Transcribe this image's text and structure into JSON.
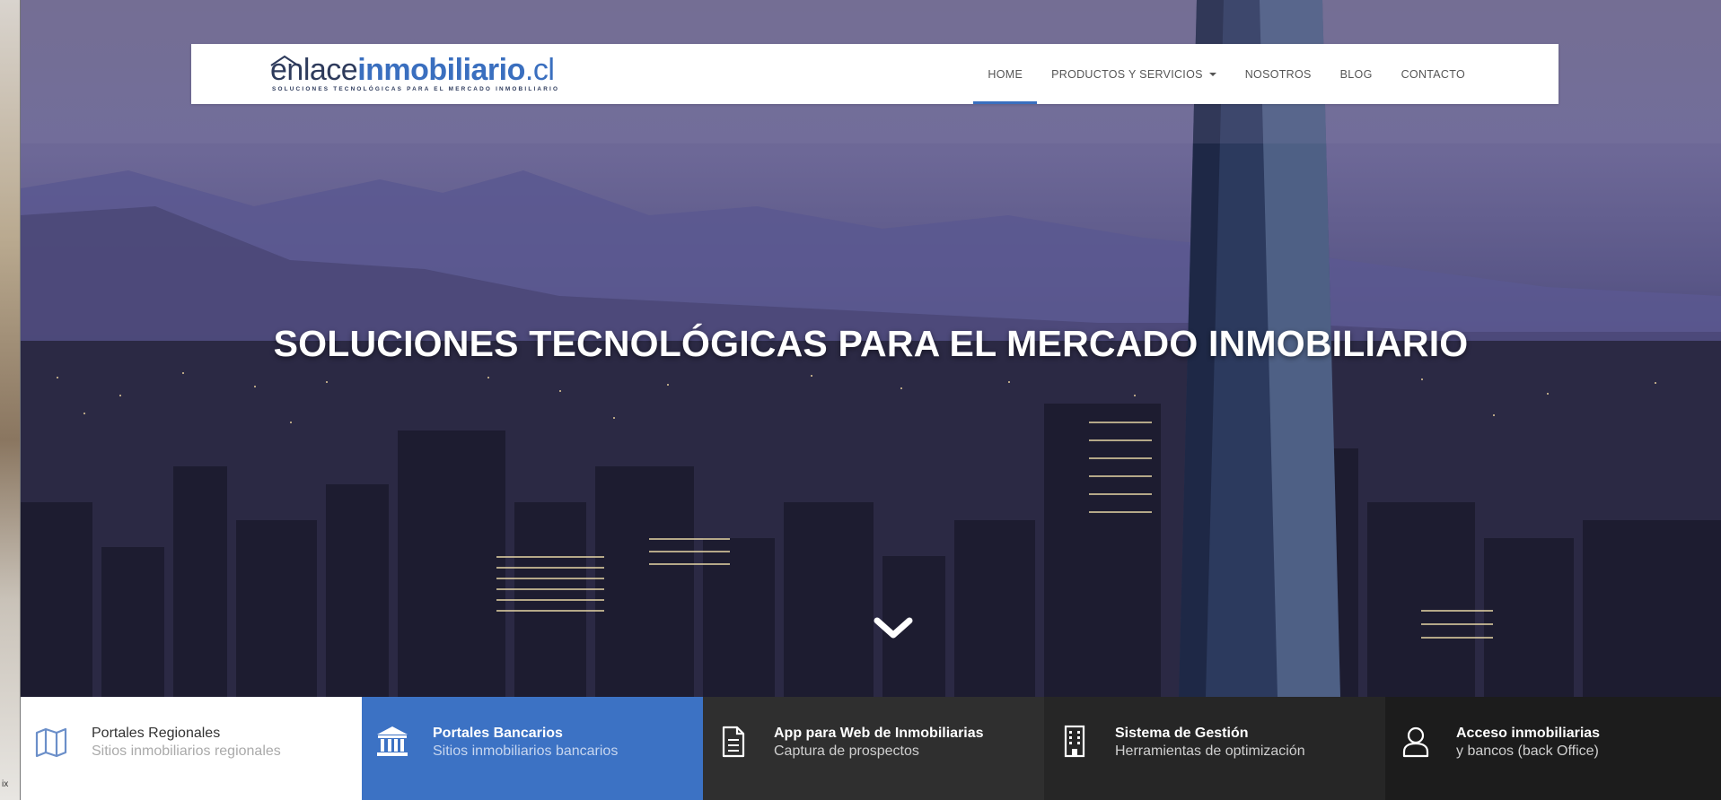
{
  "colors": {
    "brand_blue": "#3a6fbf",
    "brand_dark": "#2e3b5c",
    "feature_active": "#3c72c4",
    "feature_dark": "#2f2f2f"
  },
  "edge": {
    "text": "ix"
  },
  "logo": {
    "part_light": "enlace",
    "part_bold": "inmobiliario",
    "part_tld": ".cl",
    "tagline": "SOLUCIONES TECNOLÓGICAS PARA EL MERCADO INMOBILIARIO",
    "icon": "house-roof-icon"
  },
  "nav": {
    "items": [
      {
        "label": "HOME",
        "active": true
      },
      {
        "label": "PRODUCTOS Y SERVICIOS",
        "has_dropdown": true
      },
      {
        "label": "NOSOTROS"
      },
      {
        "label": "BLOG"
      },
      {
        "label": "CONTACTO"
      }
    ]
  },
  "hero": {
    "title": "SOLUCIONES TECNOLÓGICAS PARA EL MERCADO INMOBILIARIO",
    "scroll_icon": "chevron-down-icon"
  },
  "features": [
    {
      "title": "Portales Regionales",
      "subtitle": "Sitios inmobiliarios regionales",
      "icon": "map-icon"
    },
    {
      "title": "Portales Bancarios",
      "subtitle": "Sitios inmobiliarios bancarios",
      "icon": "bank-icon"
    },
    {
      "title": "App para Web de Inmobiliarias",
      "subtitle": "Captura de prospectos",
      "icon": "document-icon"
    },
    {
      "title": "Sistema de Gestión",
      "subtitle": "Herramientas de optimización",
      "icon": "building-icon"
    },
    {
      "title": "Acceso inmobiliarias",
      "subtitle": "y bancos (back Office)",
      "icon": "user-icon"
    }
  ]
}
